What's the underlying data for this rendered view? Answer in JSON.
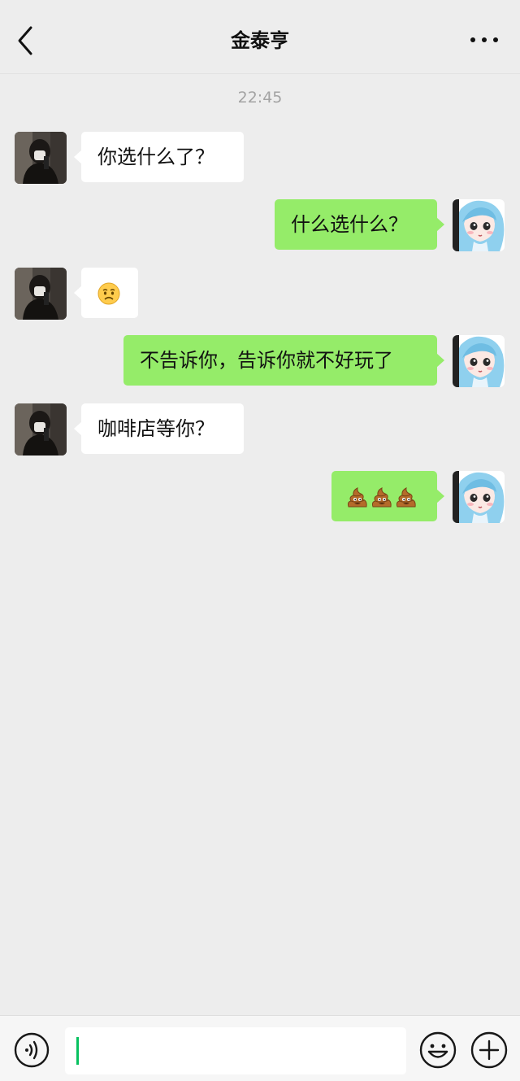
{
  "header": {
    "title": "金泰亨",
    "back_icon": "chevron-left-icon",
    "more_icon": "more-dots-icon"
  },
  "timestamp": "22:45",
  "messages": [
    {
      "side": "left",
      "text": "你选什么了？"
    },
    {
      "side": "right",
      "text": "什么选什么？"
    },
    {
      "side": "left",
      "emoji": "worried-face-emoji"
    },
    {
      "side": "right",
      "text": "不告诉你，告诉你就不好玩了"
    },
    {
      "side": "left",
      "text": "咖啡店等你？"
    },
    {
      "side": "right",
      "emoji": "pile-of-poo-emoji x3"
    }
  ],
  "input_bar": {
    "voice_icon": "voice-icon",
    "input_value": "",
    "emoji_icon": "smiley-icon",
    "plus_icon": "plus-circle-icon"
  },
  "colors": {
    "background": "#ededed",
    "sent_bubble": "#95ec69",
    "received_bubble": "#ffffff",
    "caret": "#07c160"
  }
}
